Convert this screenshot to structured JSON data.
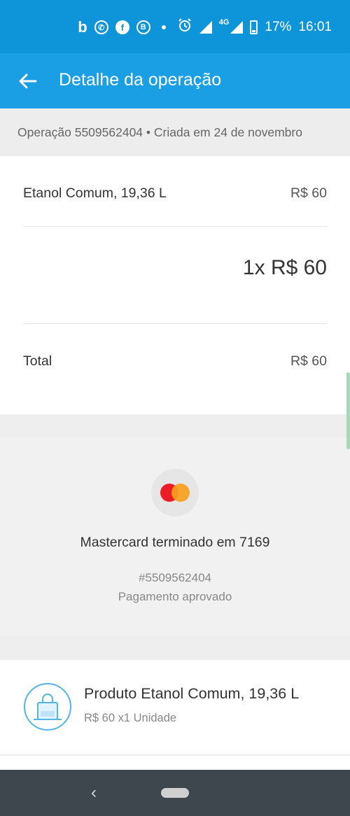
{
  "status_bar": {
    "notification_icons": [
      "b-app-icon",
      "whatsapp-icon",
      "facebook-icon",
      "b-circle-icon",
      "dot-icon"
    ],
    "network": "4G",
    "battery": "17%",
    "time": "16:01"
  },
  "app_bar": {
    "title": "Detalhe da operação",
    "back_icon": "arrow-left-icon"
  },
  "operation": {
    "header": "Operação 5509562404 • Criada em 24 de novembro"
  },
  "items": {
    "item_label": "Etanol Comum, 19,36 L",
    "item_price": "R$ 60",
    "quantity_price": "1x R$ 60",
    "total_label": "Total",
    "total_value": "R$ 60"
  },
  "payment": {
    "card_icon": "mastercard-logo",
    "card_description": "Mastercard terminado em 7169",
    "payment_id": "#5509562404",
    "status": "Pagamento aprovado"
  },
  "product": {
    "icon": "shopping-bag-icon",
    "title": "Produto Etanol Comum, 19,36 L",
    "subtitle": "R$ 60 x1 Unidade"
  },
  "nav_bar": {
    "back_icon": "chevron-left-icon",
    "home_icon": "home-pill-icon"
  },
  "colors": {
    "status_bar": "#0e95d9",
    "app_bar": "#1a9fe4",
    "mastercard_red": "#eb1c26",
    "mastercard_yellow": "#f99f1b",
    "product_icon_accent": "#52b5e8",
    "nav_bar": "#3d474d"
  }
}
